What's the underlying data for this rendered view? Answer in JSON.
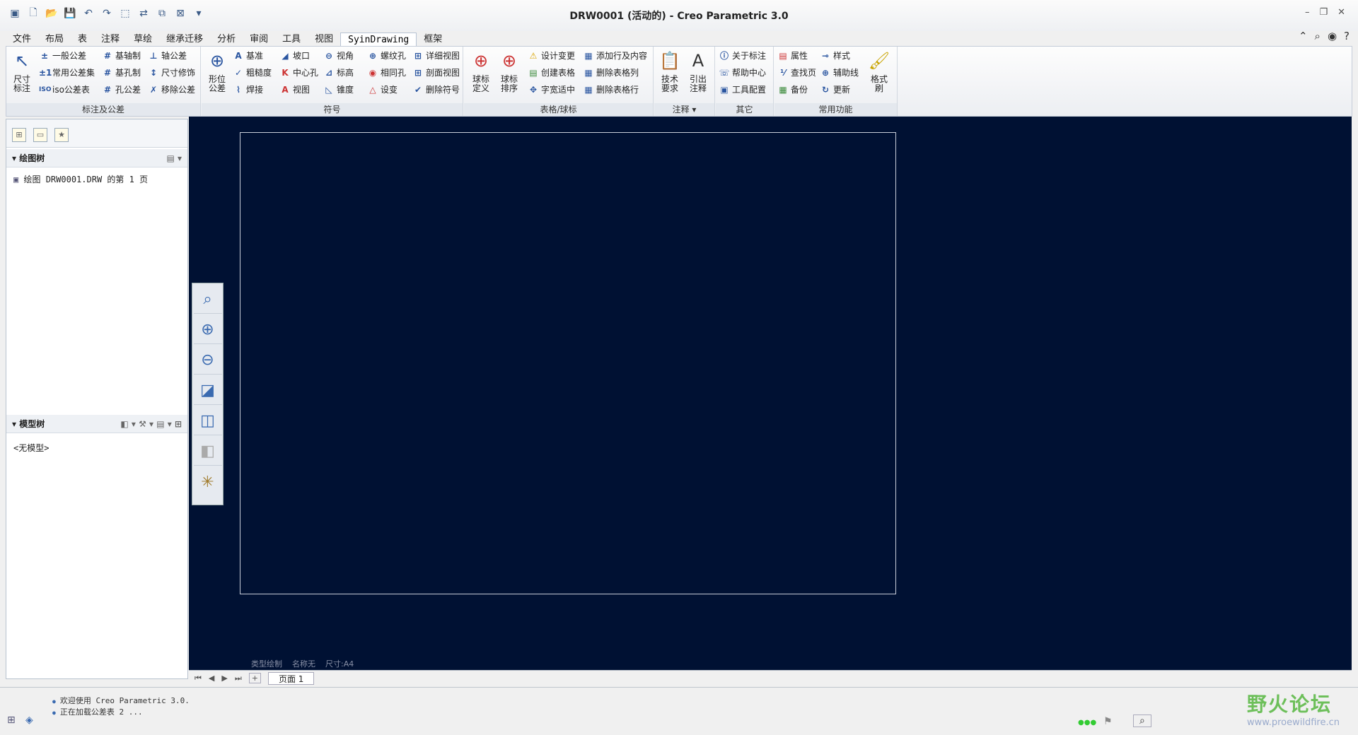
{
  "window": {
    "title": "DRW0001 (活动的) - Creo Parametric 3.0"
  },
  "menu": {
    "tabs": [
      "文件",
      "布局",
      "表",
      "注释",
      "草绘",
      "继承迁移",
      "分析",
      "审阅",
      "工具",
      "视图",
      "SyinDrawing",
      "框架"
    ],
    "active": "SyinDrawing"
  },
  "ribbon": {
    "groups": {
      "dim": {
        "label": "标注及公差",
        "big_button": "尺寸\n标注",
        "items": [
          "一般公差",
          "基轴制",
          "轴公差",
          "常用公差集",
          "基孔制",
          "尺寸修饰",
          "iso公差表",
          "孔公差",
          "移除公差"
        ]
      },
      "symbol": {
        "label": "符号",
        "big_button": "形位\n公差",
        "items": [
          "基准",
          "坡口",
          "视角",
          "螺纹孔",
          "详细视图",
          "粗糙度",
          "中心孔",
          "标高",
          "相同孔",
          "剖面视图",
          "焊接",
          "视图",
          "锥度",
          "设变",
          "删除符号"
        ]
      },
      "table": {
        "label": "表格/球标",
        "big_buttons": [
          "球标\n定义",
          "球标\n排序"
        ],
        "items": [
          "设计变更",
          "添加行及内容",
          "创建表格",
          "删除表格列",
          "字宽适中",
          "删除表格行"
        ]
      },
      "note": {
        "label": "注释",
        "big_buttons": [
          "技术\n要求",
          "引出\n注释"
        ]
      },
      "other": {
        "label": "其它",
        "items": [
          "关于标注",
          "帮助中心",
          "工具配置"
        ]
      },
      "common": {
        "label": "常用功能",
        "items": [
          "属性",
          "样式",
          "查找页",
          "辅助线",
          "备份",
          "更新"
        ],
        "big_button": "格式\n刷"
      }
    }
  },
  "left_panel": {
    "drawing_tree_title": "绘图树",
    "drawing_tree_item": "绘图 DRW0001.DRW 的第 1 页",
    "model_tree_title": "模型树",
    "model_tree_item": "<无模型>"
  },
  "sheet_info": {
    "type": "类型绘制",
    "name": "名称无",
    "size": "尺寸:A4"
  },
  "page_bar": {
    "page_tab": "页面 1"
  },
  "status": {
    "messages": [
      "欢迎使用 Creo Parametric 3.0.",
      "正在加载公差表 2 ..."
    ]
  },
  "watermark": {
    "title": "野火论坛",
    "url": "www.proewildfire.cn"
  }
}
